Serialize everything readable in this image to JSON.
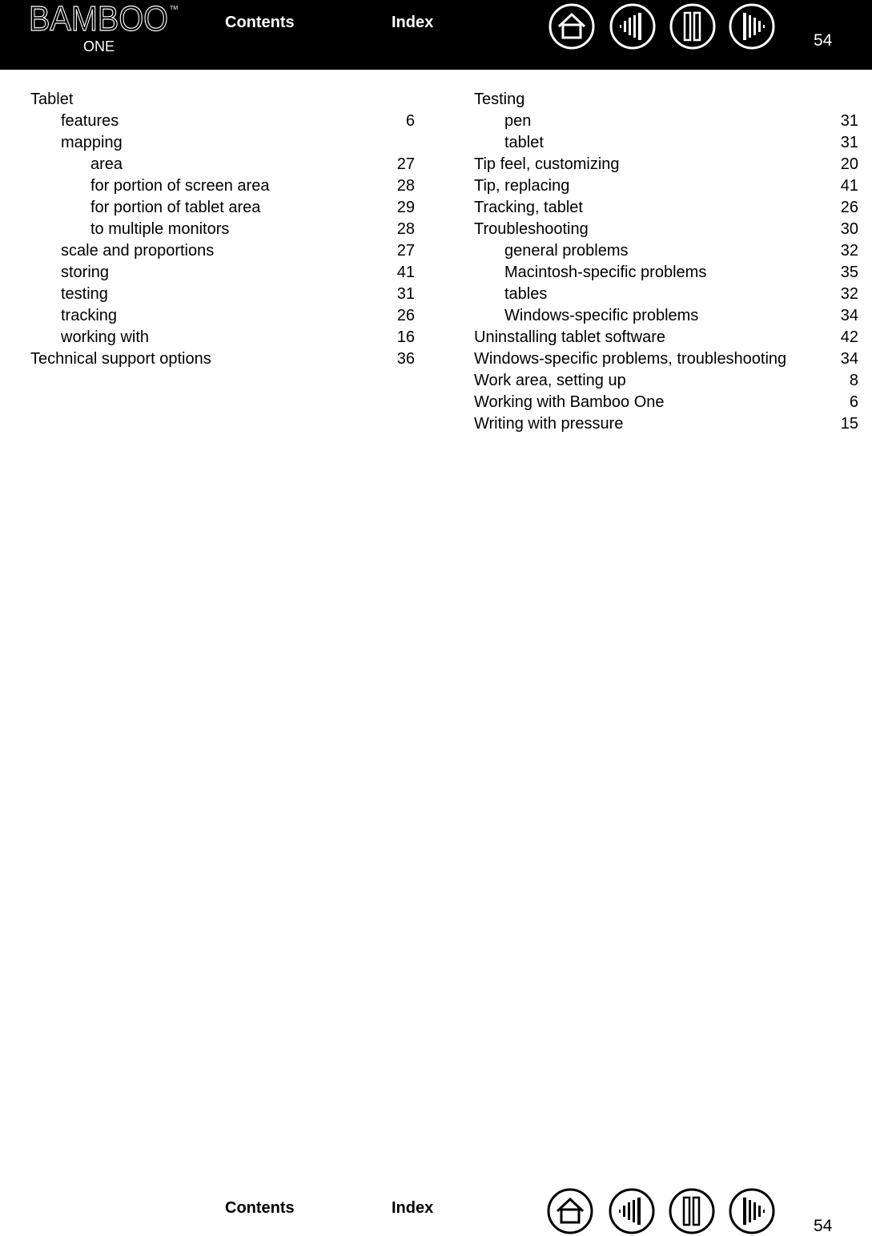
{
  "header": {
    "logo_text": "BAMBOO",
    "logo_subtext": "ONE",
    "logo_tm": "TM",
    "contents_label": "Contents",
    "index_label": "Index",
    "icons": [
      "home-icon",
      "previous-page-icon",
      "pause-icon",
      "next-page-icon"
    ],
    "page_number": "54"
  },
  "footer": {
    "contents_label": "Contents",
    "index_label": "Index",
    "icons": [
      "home-icon",
      "previous-page-icon",
      "pause-icon",
      "next-page-icon"
    ],
    "page_number": "54"
  },
  "index": {
    "left": [
      {
        "term": "Tablet",
        "page": "",
        "level": 0
      },
      {
        "term": "features",
        "page": "6",
        "level": 1
      },
      {
        "term": "mapping",
        "page": "",
        "level": 1
      },
      {
        "term": "area",
        "page": "27",
        "level": 2
      },
      {
        "term": "for portion of screen area",
        "page": "28",
        "level": 2
      },
      {
        "term": "for portion of tablet area",
        "page": "29",
        "level": 2
      },
      {
        "term": "to multiple monitors",
        "page": "28",
        "level": 2
      },
      {
        "term": "scale and proportions",
        "page": "27",
        "level": 1
      },
      {
        "term": "storing",
        "page": "41",
        "level": 1
      },
      {
        "term": "testing",
        "page": "31",
        "level": 1
      },
      {
        "term": "tracking",
        "page": "26",
        "level": 1
      },
      {
        "term": "working with",
        "page": "16",
        "level": 1
      },
      {
        "term": "Technical support options",
        "page": "36",
        "level": 0
      }
    ],
    "right": [
      {
        "term": "Testing",
        "page": "",
        "level": 0
      },
      {
        "term": "pen",
        "page": "31",
        "level": 1
      },
      {
        "term": "tablet",
        "page": "31",
        "level": 1
      },
      {
        "term": "Tip feel, customizing",
        "page": "20",
        "level": 0
      },
      {
        "term": "Tip, replacing",
        "page": "41",
        "level": 0
      },
      {
        "term": "Tracking, tablet",
        "page": "26",
        "level": 0
      },
      {
        "term": "Troubleshooting",
        "page": "30",
        "level": 0
      },
      {
        "term": "general problems",
        "page": "32",
        "level": 1
      },
      {
        "term": "Macintosh-specific problems",
        "page": "35",
        "level": 1
      },
      {
        "term": "tables",
        "page": "32",
        "level": 1
      },
      {
        "term": "Windows-specific problems",
        "page": "34",
        "level": 1
      },
      {
        "term": "Uninstalling tablet software",
        "page": "42",
        "level": 0
      },
      {
        "term": "Windows-specific problems, troubleshooting",
        "page": "34",
        "level": 0
      },
      {
        "term": "Work area, setting up",
        "page": "8",
        "level": 0
      },
      {
        "term": "Working with Bamboo One",
        "page": "6",
        "level": 0
      },
      {
        "term": "Writing with pressure",
        "page": "15",
        "level": 0
      }
    ]
  }
}
